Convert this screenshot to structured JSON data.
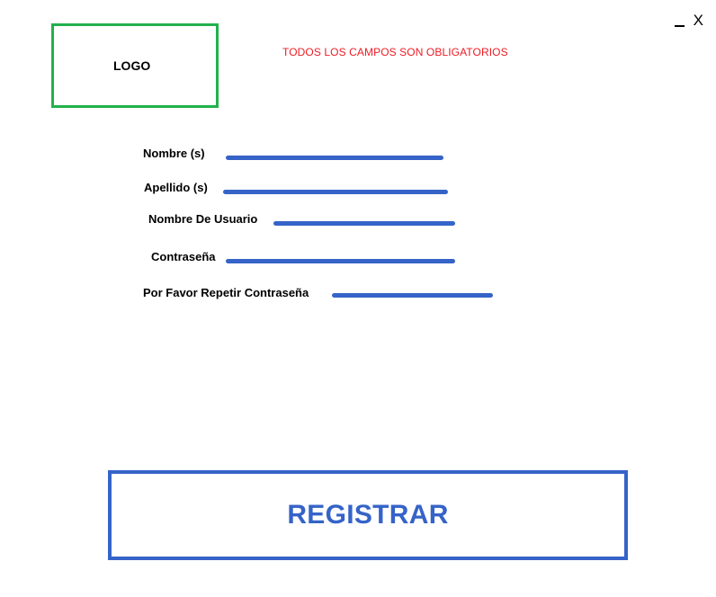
{
  "window": {
    "minimize_icon": "minimize-icon",
    "close_label": "X"
  },
  "logo": {
    "label": "LOGO",
    "border_color": "#22b14c"
  },
  "notice": {
    "text": "TODOS LOS CAMPOS SON OBLIGATORIOS",
    "color": "#ed1c24"
  },
  "form": {
    "fields": [
      {
        "label": "Nombre (s)",
        "value": ""
      },
      {
        "label": "Apellido (s)",
        "value": ""
      },
      {
        "label": "Nombre De Usuario",
        "value": ""
      },
      {
        "label": "Contraseña",
        "value": ""
      },
      {
        "label": "Por Favor Repetir Contraseña",
        "value": ""
      }
    ],
    "line_color": "#3563c8"
  },
  "register_button": {
    "label": "REGISTRAR",
    "color": "#3563c8"
  }
}
